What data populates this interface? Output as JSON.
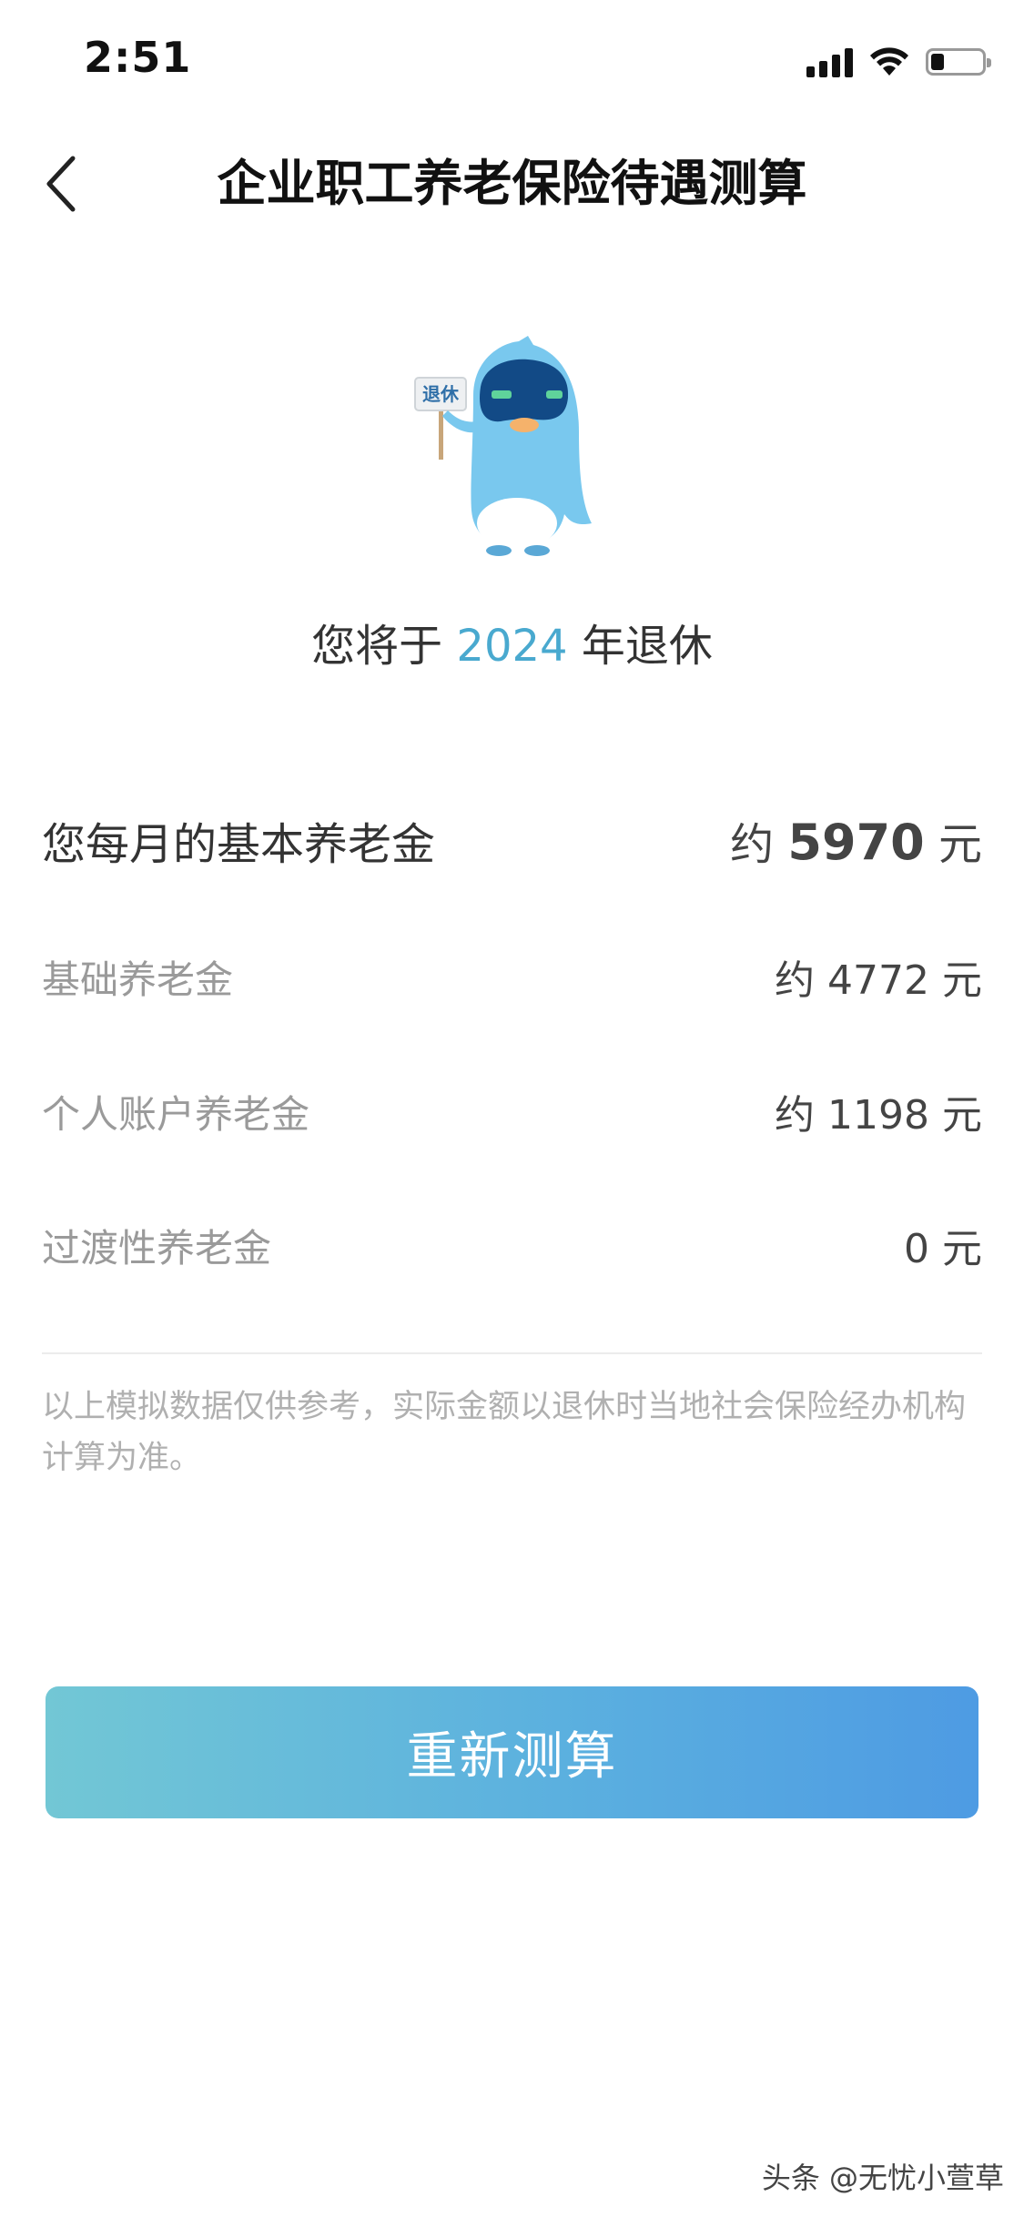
{
  "status_bar": {
    "time": "2:51"
  },
  "header": {
    "title": "企业职工养老保险待遇测算"
  },
  "mascot": {
    "sign_text": "退休"
  },
  "retire": {
    "prefix": "您将于",
    "year": "2024",
    "suffix": "年退休"
  },
  "pension": {
    "monthly": {
      "label": "您每月的基本养老金",
      "approx": "约",
      "amount": "5970",
      "unit": "元"
    },
    "basic": {
      "label": "基础养老金",
      "value": "约 4772 元"
    },
    "personal": {
      "label": "个人账户养老金",
      "value": "约 1198 元"
    },
    "transitional": {
      "label": "过渡性养老金",
      "value": "0 元"
    }
  },
  "disclaimer": "以上模拟数据仅供参考，实际金额以退休时当地社会保险经办机构计算为准。",
  "actions": {
    "recalculate": "重新测算"
  },
  "watermark": "头条 @无忧小萱草",
  "colors": {
    "accent": "#49a9cf",
    "button_start": "#72c7d5",
    "button_end": "#4e9be3"
  }
}
